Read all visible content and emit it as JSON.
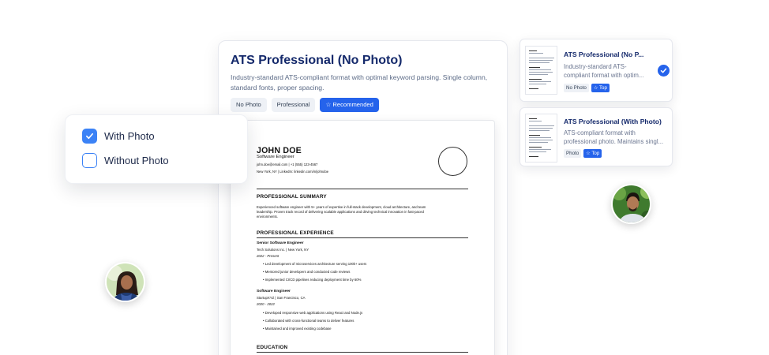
{
  "main_template": {
    "title": "ATS Professional (No Photo)",
    "description": "Industry-standard ATS-compliant format with optimal keyword parsing. Single column, standard fonts, proper spacing.",
    "tags": [
      "No Photo",
      "Professional"
    ],
    "recommended_label": "☆ Recommended"
  },
  "resume": {
    "name": "JOHN DOE",
    "role": "Software Engineer",
    "contact": "john.doe@email.com | +1 (555) 123-4567",
    "location": "New York, NY | LinkedIn: linkedin.com/in/johndoe",
    "summary_heading": "PROFESSIONAL SUMMARY",
    "summary_line1": "Experienced software engineer with 5+ years of expertise in full-stack development, cloud architecture, and team",
    "summary_line2": "leadership. Proven track record of delivering scalable applications and driving technical innovation in fast-paced",
    "summary_line3": "environments.",
    "experience_heading": "PROFESSIONAL EXPERIENCE",
    "jobs": [
      {
        "title": "Senior Software Engineer",
        "company": "Tech Solutions Inc. | New York, NY",
        "dates": "2022 - Present",
        "bullets": [
          "• Led development of microservices architecture serving 100k+ users",
          "• Mentored junior developers and conducted code reviews",
          "• Implemented CI/CD pipelines reducing deployment time by 60%"
        ]
      },
      {
        "title": "Software Engineer",
        "company": "StartupXYZ | San Francisco, CA",
        "dates": "2020 - 2022",
        "bullets": [
          "• Developed responsive web applications using React and Node.js",
          "• Collaborated with cross-functional teams to deliver features",
          "• Maintained and improved existing codebase"
        ]
      }
    ],
    "education_heading": "EDUCATION"
  },
  "photo_options": {
    "with_photo": "With Photo",
    "without_photo": "Without Photo",
    "with_photo_checked": true,
    "without_photo_checked": false
  },
  "side_templates": [
    {
      "title": "ATS Professional (No P...",
      "desc_line1": "Industry-standard ATS-",
      "desc_line2": "compliant format with optim...",
      "tag": "No Photo",
      "top_label": "☆ Top",
      "selected": true
    },
    {
      "title": "ATS Professional (With Photo)",
      "desc_line1": "ATS-compliant format with",
      "desc_line2": "professional photo. Maintains singl...",
      "tag": "Photo",
      "top_label": "☆ Top",
      "selected": false
    }
  ],
  "colors": {
    "accent": "#2563eb",
    "title": "#14296b",
    "checkbox": "#3b82f6"
  }
}
